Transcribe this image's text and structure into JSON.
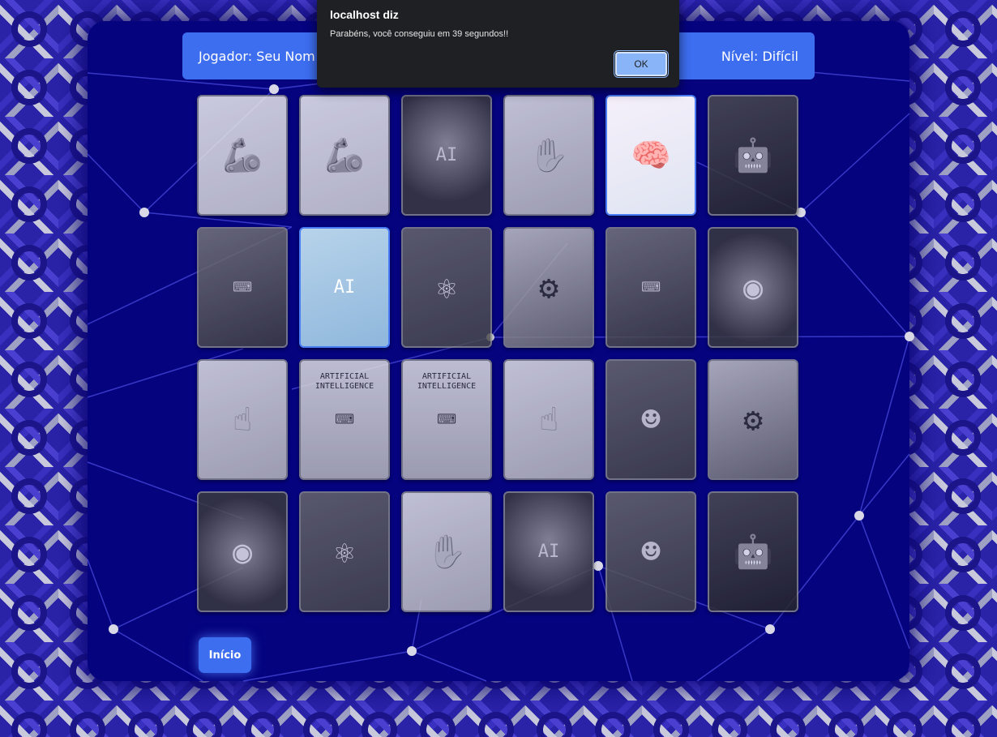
{
  "header": {
    "player_label": "Jogador: Seu Nom",
    "level_label": "Nível: Difícil"
  },
  "cards": [
    {
      "theme": "robotlight",
      "state": "matched",
      "glyph": "🦾"
    },
    {
      "theme": "robotlight",
      "state": "matched",
      "glyph": "🦾"
    },
    {
      "theme": "city",
      "state": "matched",
      "glyph": "AI"
    },
    {
      "theme": "hand",
      "state": "matched",
      "glyph": "✋"
    },
    {
      "theme": "brain",
      "state": "revealed",
      "glyph": "🧠"
    },
    {
      "theme": "dark",
      "state": "matched",
      "glyph": "🤖"
    },
    {
      "theme": "laptop",
      "state": "matched",
      "glyph": "⌨"
    },
    {
      "theme": "ai",
      "state": "revealed",
      "glyph": "AI"
    },
    {
      "theme": "coil",
      "state": "matched",
      "glyph": "⚛"
    },
    {
      "theme": "machine",
      "state": "matched",
      "glyph": "⚙"
    },
    {
      "theme": "laptop",
      "state": "matched",
      "glyph": "⌨"
    },
    {
      "theme": "portal",
      "state": "matched",
      "glyph": "◉"
    },
    {
      "theme": "hand",
      "state": "matched",
      "glyph": "☝"
    },
    {
      "theme": "typewriter",
      "state": "matched",
      "glyph": "⌨",
      "caption": "ARTIFICIAL INTELLIGENCE"
    },
    {
      "theme": "typewriter",
      "state": "matched",
      "glyph": "⌨",
      "caption": "ARTIFICIAL INTELLIGENCE"
    },
    {
      "theme": "hand",
      "state": "matched",
      "glyph": "☝"
    },
    {
      "theme": "face",
      "state": "matched",
      "glyph": "☻"
    },
    {
      "theme": "machine",
      "state": "matched",
      "glyph": "⚙"
    },
    {
      "theme": "portal",
      "state": "matched",
      "glyph": "◉"
    },
    {
      "theme": "coil",
      "state": "matched",
      "glyph": "⚛"
    },
    {
      "theme": "hand",
      "state": "matched",
      "glyph": "✋"
    },
    {
      "theme": "city",
      "state": "matched",
      "glyph": "AI"
    },
    {
      "theme": "face",
      "state": "matched",
      "glyph": "☻"
    },
    {
      "theme": "dark",
      "state": "matched",
      "glyph": "🤖"
    }
  ],
  "footer": {
    "start_button": "Início"
  },
  "dialog": {
    "title": "localhost diz",
    "message": "Parabéns, você conseguiu em 39 segundos!!",
    "ok_button": "OK"
  },
  "colors": {
    "panel": "#05037e",
    "accent": "#3d6ef0",
    "dialog_bg": "#1f2023",
    "ok_button": "#8ab4f8"
  }
}
